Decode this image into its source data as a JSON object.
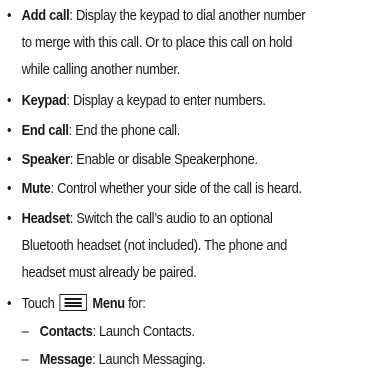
{
  "bullet_char": "•",
  "dash_char": "–",
  "items": [
    {
      "term": "Add call",
      "lines": [
        ": Display the keypad to dial another number",
        "to merge with this call. Or to place this call on hold",
        "while calling another number."
      ]
    },
    {
      "term": "Keypad",
      "lines": [
        ": Display a keypad to enter numbers."
      ]
    },
    {
      "term": "End call",
      "lines": [
        ": End the phone call."
      ]
    },
    {
      "term": "Speaker",
      "lines": [
        ": Enable or disable Speakerphone."
      ]
    },
    {
      "term": "Mute",
      "lines": [
        ": Control whether your side of the call is heard."
      ]
    },
    {
      "term": "Headset",
      "lines": [
        ": Switch the call’s audio to an optional",
        "Bluetooth headset (not included). The phone and",
        "headset must already be paired."
      ]
    }
  ],
  "menu_line": {
    "prefix": "Touch",
    "icon": "menu-icon",
    "term": "Menu",
    "suffix": " for:"
  },
  "sub_items": [
    {
      "term": "Contacts",
      "text": ": Launch Contacts."
    },
    {
      "term": "Message",
      "text": ": Launch Messaging."
    }
  ]
}
